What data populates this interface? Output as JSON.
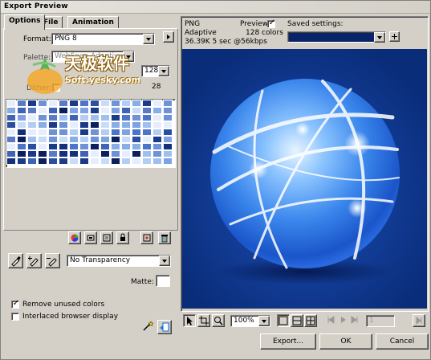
{
  "window": {
    "title": "Export Preview"
  },
  "tabs": [
    {
      "label": "Options"
    },
    {
      "label": "File"
    },
    {
      "label": "Animation"
    }
  ],
  "options": {
    "format_label": "Format:",
    "format_value": "PNG 8",
    "palette_label": "Palette:",
    "palette_value": "WebSnap Adaptive",
    "colors_value": "128",
    "dither_label": "Dither:",
    "dither_pct": "28",
    "transparency_value": "No Transparency",
    "matte_label": "Matte:",
    "remove_unused_label": "Remove unused colors",
    "remove_unused_checked": true,
    "interlaced_label": "Interlaced browser display",
    "interlaced_checked": false
  },
  "preview": {
    "format": "PNG",
    "palette": "Adaptive",
    "size_info": "36.39K  5 sec @56kbps",
    "preview_label": "Preview",
    "preview_checked": true,
    "colors_count": "128 colors",
    "saved_settings_label": "Saved settings:"
  },
  "bottom_toolbar": {
    "zoom_value": "100%",
    "frame_value": "1"
  },
  "buttons": {
    "export": "Export...",
    "ok": "OK",
    "cancel": "Cancel"
  },
  "watermark": {
    "cn": "天极软件",
    "url": "Soft.yesky.com"
  },
  "colors": {
    "window_bg": "#d4d0c8",
    "saved_settings_bar": "#0a246a",
    "canvas_bg": "#0a2d7a"
  }
}
